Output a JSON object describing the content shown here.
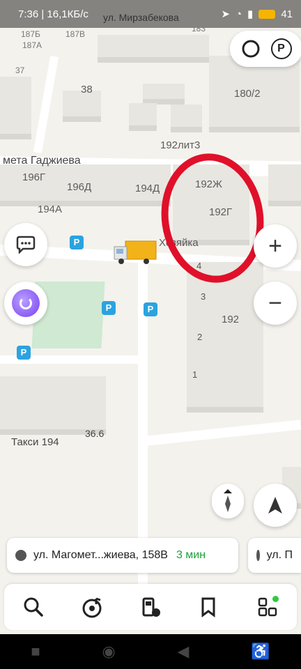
{
  "status_bar": {
    "time": "7:36 | 16,1КБ/с",
    "street_peek": "ул. Мирзабекова",
    "battery": "41"
  },
  "map": {
    "street_label": "мета Гаджиева",
    "building_labels": {
      "b187b_1": "187Б",
      "b187v": "187В",
      "b187a": "187А",
      "b183": "183",
      "b37": "37",
      "b38": "38",
      "b180_2": "180/2",
      "b192lit3": "192лит3",
      "b196g": "196Г",
      "b196d": "196Д",
      "b194d": "194Д",
      "b192zh": "192Ж",
      "b192g": "192Г",
      "b194a": "194А",
      "b192": "192",
      "b36_6": "36.6",
      "poi_label": "Хозяйка"
    },
    "entrances": [
      "4",
      "3",
      "2",
      "1"
    ],
    "taxi_label": "Такси 194",
    "parking_glyph": "P"
  },
  "controls": {
    "parking_button": "P",
    "zoom_in": "+",
    "zoom_out": "−"
  },
  "routes": [
    {
      "address": "ул. Магомет...жиева, 158В",
      "eta": "3 мин"
    },
    {
      "address": "ул. П",
      "eta": ""
    }
  ],
  "colors": {
    "accent_green": "#1aa33a",
    "annotation_red": "#e0102a",
    "parking_blue": "#2ba3e0",
    "alice_purple": "#7b3ff2"
  }
}
